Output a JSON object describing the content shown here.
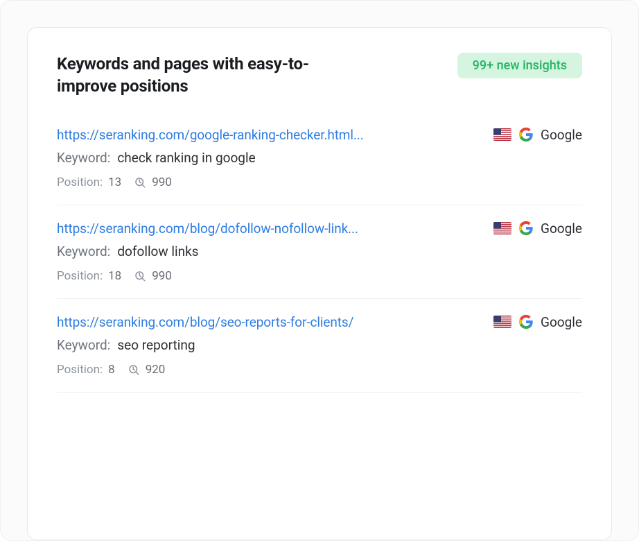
{
  "header": {
    "title": "Keywords and pages with easy-to-improve positions",
    "badge": "99+ new insights"
  },
  "labels": {
    "keyword": "Keyword:",
    "position": "Position:"
  },
  "engine": {
    "name": "Google",
    "country_flag": "us"
  },
  "insights": [
    {
      "url": "https://seranking.com/google-ranking-checker.html...",
      "keyword": "check ranking in google",
      "position": "13",
      "volume": "990"
    },
    {
      "url": "https://seranking.com/blog/dofollow-nofollow-link...",
      "keyword": "dofollow links",
      "position": "18",
      "volume": "990"
    },
    {
      "url": "https://seranking.com/blog/seo-reports-for-clients/",
      "keyword": "seo reporting",
      "position": "8",
      "volume": "920"
    }
  ]
}
